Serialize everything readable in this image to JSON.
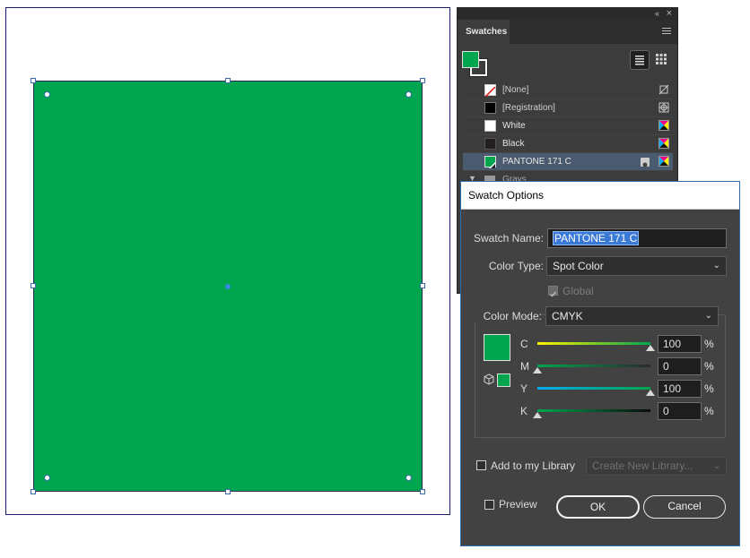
{
  "swatches_panel": {
    "collapse_glyph": "«",
    "close_glyph": "×",
    "tab_label": "Swatches",
    "items": [
      {
        "name": "[None]",
        "color": "none"
      },
      {
        "name": "[Registration]",
        "color": "#000000"
      },
      {
        "name": "White",
        "color": "#ffffff"
      },
      {
        "name": "Black",
        "color": "#231f20"
      },
      {
        "name": "PANTONE 171 C",
        "color": "#00a550",
        "selected": true
      },
      {
        "name": "Grays",
        "color": "folder"
      }
    ],
    "icons": [
      "list-view-icon",
      "thumbnail-view-icon",
      "panel-menu-icon"
    ]
  },
  "dialog": {
    "title": "Swatch Options",
    "swatch_name_label": "Swatch Name:",
    "swatch_name_value": "PANTONE 171 C",
    "color_type_label": "Color Type:",
    "color_type_value": "Spot Color",
    "global_label": "Global",
    "global_checked": true,
    "color_mode_label": "Color Mode:",
    "color_mode_value": "CMYK",
    "channels": [
      {
        "label": "C",
        "value": "100",
        "unit": "%"
      },
      {
        "label": "M",
        "value": "0",
        "unit": "%"
      },
      {
        "label": "Y",
        "value": "100",
        "unit": "%"
      },
      {
        "label": "K",
        "value": "0",
        "unit": "%"
      }
    ],
    "add_library_label": "Add to my Library",
    "library_placeholder": "Create New Library...",
    "preview_label": "Preview",
    "ok_label": "OK",
    "cancel_label": "Cancel"
  },
  "colors": {
    "swatch_green": "#00a550",
    "selection_blue": "#3a79d6"
  }
}
